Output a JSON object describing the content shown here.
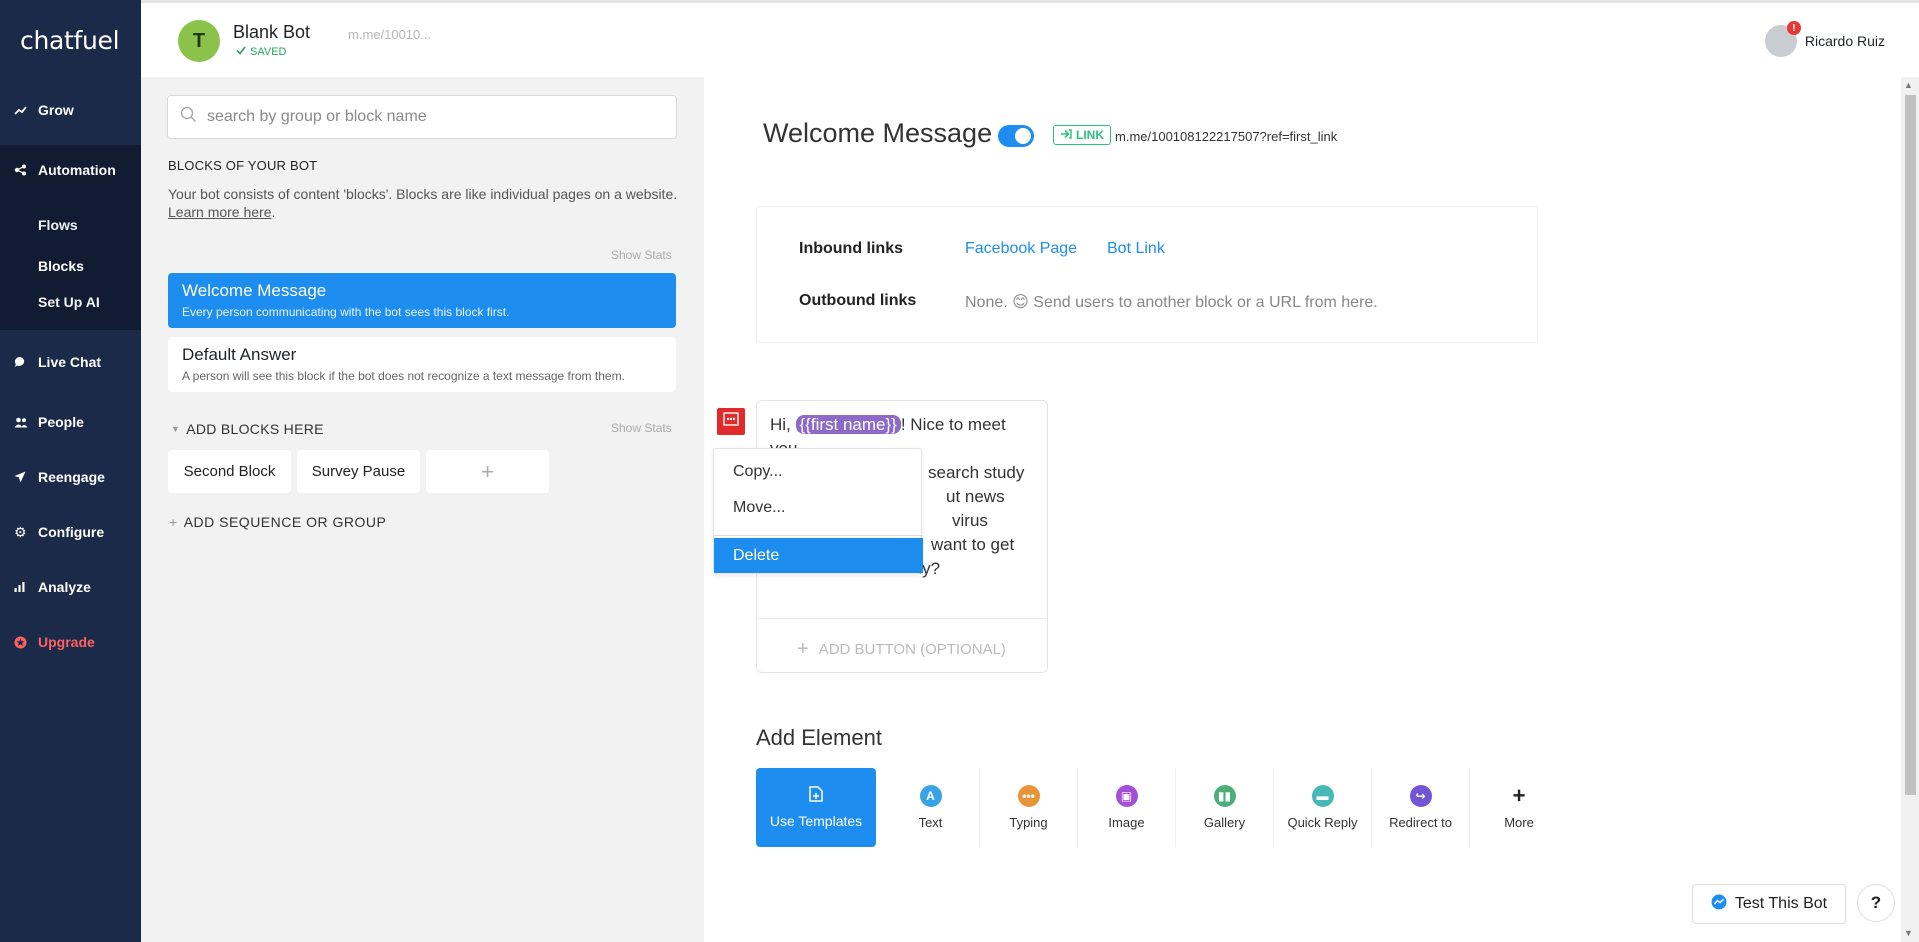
{
  "app": {
    "logo": "chatfuel"
  },
  "sidebar": {
    "items": [
      {
        "label": "Grow",
        "icon": "trend-icon"
      },
      {
        "label": "Automation",
        "icon": "flow-icon"
      },
      {
        "label": "Live Chat",
        "icon": "chat-icon"
      },
      {
        "label": "People",
        "icon": "people-icon"
      },
      {
        "label": "Reengage",
        "icon": "send-icon"
      },
      {
        "label": "Configure",
        "icon": "gear-icon"
      },
      {
        "label": "Analyze",
        "icon": "bars-icon"
      },
      {
        "label": "Upgrade",
        "icon": "star-icon"
      }
    ],
    "sub_items": [
      "Flows",
      "Blocks",
      "Set Up AI"
    ]
  },
  "header": {
    "avatar_letter": "T",
    "bot_name": "Blank Bot",
    "saved": "SAVED",
    "bot_url": "m.me/10010...",
    "user_name": "Ricardo Ruiz",
    "notifications": "!"
  },
  "blocks": {
    "search_placeholder": "search by group or block name",
    "section_title": "BLOCKS OF YOUR BOT",
    "description": "Your bot consists of content 'blocks'. Blocks are like individual pages on a website.",
    "learn_more": "Learn more here",
    "show_stats": "Show Stats",
    "cards": [
      {
        "title": "Welcome Message",
        "subtitle": "Every person communicating with the bot sees this block first."
      },
      {
        "title": "Default Answer",
        "subtitle": "A person will see this block if the bot does not recognize a text message from them."
      }
    ],
    "group_title": "ADD BLOCKS HERE",
    "chips": [
      "Second Block",
      "Survey Pause",
      "+"
    ],
    "add_sequence": "ADD SEQUENCE OR GROUP"
  },
  "main": {
    "title": "Welcome Message",
    "link_badge": "LINK",
    "link_url": "m.me/100108122217507?ref=first_link",
    "inbound_label": "Inbound links",
    "inbound_links": [
      "Facebook Page",
      "Bot Link"
    ],
    "outbound_label": "Outbound links",
    "outbound_text": "None. 😊 Send users to another block or a URL from here.",
    "message": {
      "prefix": "Hi, ",
      "variable": "{{first name}}",
      "line1_suffix": "! Nice to meet",
      "line2": "you.",
      "line3": "search study",
      "line4": "ut news",
      "line5": "virus",
      "line6": "want to get",
      "line7": "started with the study?"
    },
    "add_button": "ADD BUTTON (OPTIONAL)",
    "context_menu": [
      "Copy...",
      "Move...",
      "Delete"
    ],
    "add_element_title": "Add Element",
    "elements": [
      "Use Templates",
      "Text",
      "Typing",
      "Image",
      "Gallery",
      "Quick Reply",
      "Redirect to",
      "More"
    ],
    "element_colors": [
      "#1d8df0",
      "#3aa3e8",
      "#e8953a",
      "#a34fd6",
      "#4caf7a",
      "#46b8b8",
      "#7255d6",
      "#222222"
    ],
    "test_button": "Test This Bot",
    "help_button": "?"
  }
}
